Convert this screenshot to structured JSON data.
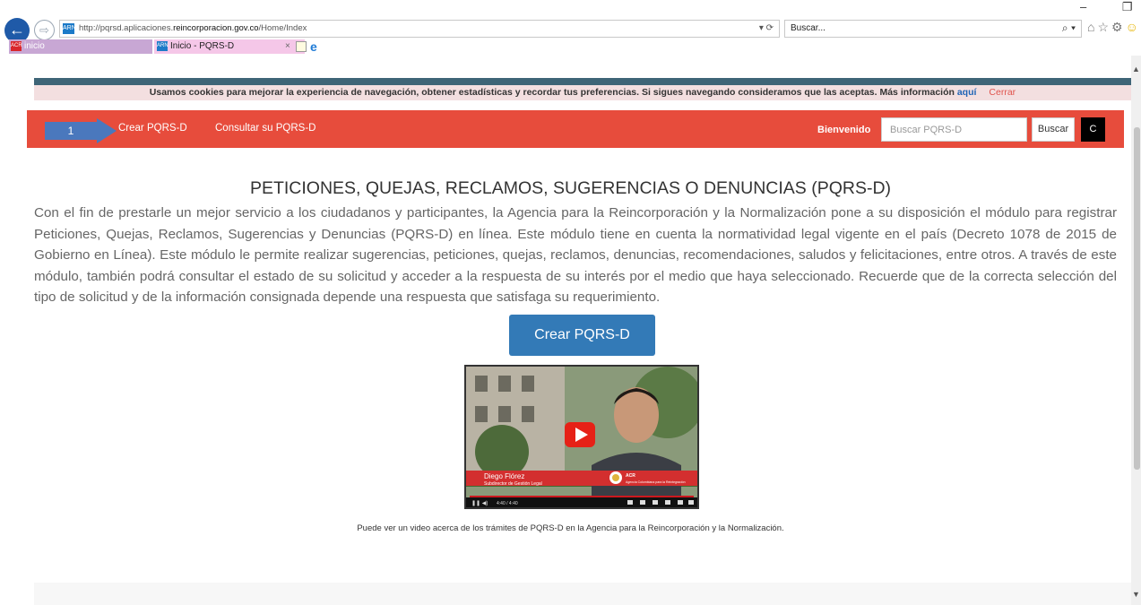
{
  "browser": {
    "back_glyph": "←",
    "forward_glyph": "⇨",
    "url_prefix": "http://pqrsd.aplicaciones.",
    "url_host": "reincorporacion.gov.co",
    "url_path": "/Home/Index",
    "address_controls": "▾ ⟳",
    "search_placeholder": "Buscar...",
    "search_icon": "⌕ ▾",
    "tabs": [
      {
        "label": "inicio",
        "favicon": "ACR"
      },
      {
        "label": "Inicio - PQRS-D",
        "favicon": "ARN",
        "close": "×"
      }
    ],
    "window_controls": "– ❐ ✕",
    "toolbar_icons": "⌂☆⚙",
    "smiley": "☺"
  },
  "cookie_bar": {
    "message": "Usamos cookies para mejorar la experiencia de navegación, obtener estadísticas y recordar tus preferencias. Si sigues navegando consideramos que las aceptas. Más información ",
    "link": "aquí",
    "close": "Cerrar"
  },
  "navbar": {
    "annotation_number": "1",
    "items": [
      "Crear PQRS-D",
      "Consultar su PQRS-D"
    ],
    "welcome": "Bienvenido",
    "search_placeholder": "Buscar PQRS-D",
    "search_button": "Buscar",
    "c_button": "C"
  },
  "main": {
    "title": "PETICIONES, QUEJAS, RECLAMOS, SUGERENCIAS O DENUNCIAS (PQRS-D)",
    "intro": "Con el fin de prestarle un mejor servicio a los ciudadanos y participantes, la Agencia para la Reincorporación y la Normalización pone a su disposición el módulo para registrar Peticiones, Quejas, Reclamos, Sugerencias y Denuncias (PQRS-D) en línea. Este módulo tiene en cuenta la normatividad legal vigente en el país (Decreto 1078 de 2015 de Gobierno en Línea). Este módulo le permite realizar sugerencias, peticiones, quejas, reclamos, denuncias, recomendaciones, saludos y felicitaciones, entre otros. A través de este módulo, también podrá consultar el estado de su solicitud y acceder a la respuesta de su interés por el medio que haya seleccionado. Recuerde que de la correcta selección del tipo de solicitud y de la información consignada depende una respuesta que satisfaga su requerimiento.",
    "create_button": "Crear PQRS-D",
    "video": {
      "name": "Diego Flórez",
      "role": "Subdirector de Gestión Legal",
      "org_abbrev": "ACR",
      "org_text": "Agencia Colombiana para la Reintegración",
      "time": "4:40 / 4:40"
    },
    "caption": "Puede ver un video acerca de los trámites de PQRS-D en la Agencia para la Reincorporación y la Normalización."
  },
  "colors": {
    "navbar": "#e74c3c",
    "primary_button": "#337ab7",
    "cookie_bg": "#f3dfe0",
    "top_bar": "#3e6577"
  }
}
